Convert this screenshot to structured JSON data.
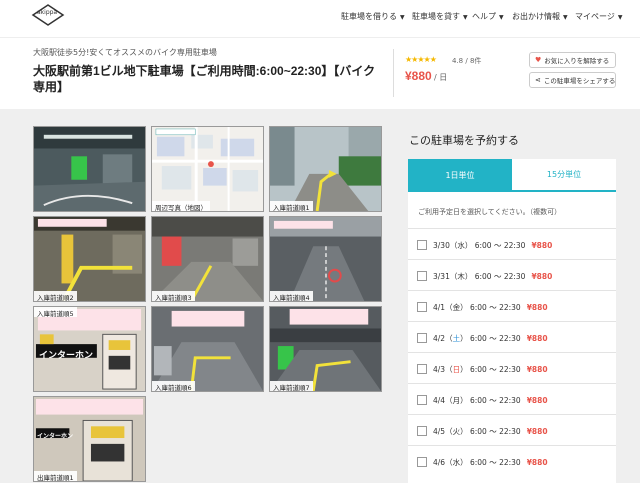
{
  "nav": {
    "logo_text": "akippa",
    "items": [
      {
        "label": "駐車場を借りる"
      },
      {
        "label": "駐車場を貸す"
      },
      {
        "label": "ヘルプ"
      },
      {
        "label": "お出かけ情報"
      },
      {
        "label": "マイページ"
      }
    ]
  },
  "header": {
    "subtitle": "大阪駅徒歩5分!安くてオススメのバイク専用駐車場",
    "title": "大阪駅前第1ビル地下駐車場【ご利用時間:6:00~22:30】【バイク専用】",
    "stars": "★★★★★",
    "rating": "4.8 / 8件",
    "price": "¥880",
    "price_unit": "/ 日",
    "favorite_label": "お気に入りを解除する",
    "share_label": "この駐車場をシェアする"
  },
  "photos": [
    {
      "caption": ""
    },
    {
      "caption": "周辺写真（地図）"
    },
    {
      "caption": "入庫前道順1"
    },
    {
      "caption": "入庫前道順2"
    },
    {
      "caption": "入庫前道順3"
    },
    {
      "caption": "入庫前道順4"
    },
    {
      "caption": "入庫前道順5"
    },
    {
      "caption": "入庫前道順6"
    },
    {
      "caption": "入庫前道順7"
    },
    {
      "caption": "出庫前道順1"
    }
  ],
  "photo_texts": {
    "intercom": "インターホン",
    "intercom_small": "インターホン"
  },
  "reservation": {
    "title": "この駐車場を予約する",
    "tab_day": "1日単位",
    "tab_15min": "15分単位",
    "hint": "ご利用予定日を選択してください。（複数可）",
    "rows": [
      {
        "date": "3/30",
        "wd": "水",
        "type": "wd",
        "time": "6:00 ～ 22:30",
        "price": "¥880"
      },
      {
        "date": "3/31",
        "wd": "木",
        "type": "wd",
        "time": "6:00 ～ 22:30",
        "price": "¥880"
      },
      {
        "date": "4/1",
        "wd": "金",
        "type": "wd",
        "time": "6:00 ～ 22:30",
        "price": "¥880"
      },
      {
        "date": "4/2",
        "wd": "土",
        "type": "sat",
        "time": "6:00 ～ 22:30",
        "price": "¥880"
      },
      {
        "date": "4/3",
        "wd": "日",
        "type": "sun",
        "time": "6:00 ～ 22:30",
        "price": "¥880"
      },
      {
        "date": "4/4",
        "wd": "月",
        "type": "wd",
        "time": "6:00 ～ 22:30",
        "price": "¥880"
      },
      {
        "date": "4/5",
        "wd": "火",
        "type": "wd",
        "time": "6:00 ～ 22:30",
        "price": "¥880"
      },
      {
        "date": "4/6",
        "wd": "水",
        "type": "wd",
        "time": "6:00 ～ 22:30",
        "price": "¥880"
      }
    ]
  },
  "colors": {
    "accent": "#22b3c6",
    "price": "#e8544a",
    "background": "#efefef"
  }
}
